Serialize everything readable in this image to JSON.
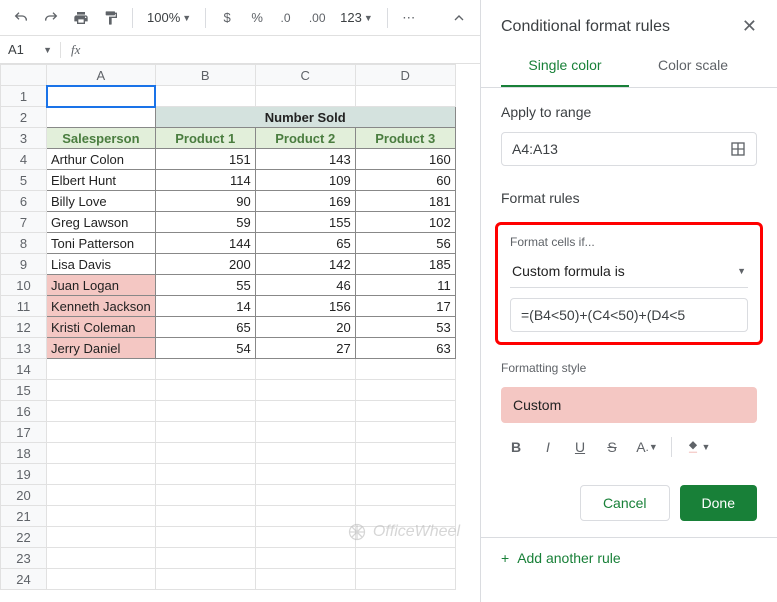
{
  "toolbar": {
    "zoom": "100%",
    "decimal": "123"
  },
  "namebox": "A1",
  "columns": [
    "A",
    "B",
    "C",
    "D"
  ],
  "header_merged": "Number Sold",
  "col_headers": [
    "Salesperson",
    "Product 1",
    "Product 2",
    "Product 3"
  ],
  "rows": [
    {
      "name": "Arthur Colon",
      "p1": 151,
      "p2": 143,
      "p3": 160,
      "hl": false
    },
    {
      "name": "Elbert Hunt",
      "p1": 114,
      "p2": 109,
      "p3": 60,
      "hl": false
    },
    {
      "name": "Billy Love",
      "p1": 90,
      "p2": 169,
      "p3": 181,
      "hl": false
    },
    {
      "name": "Greg Lawson",
      "p1": 59,
      "p2": 155,
      "p3": 102,
      "hl": false
    },
    {
      "name": "Toni Patterson",
      "p1": 144,
      "p2": 65,
      "p3": 56,
      "hl": false
    },
    {
      "name": "Lisa Davis",
      "p1": 200,
      "p2": 142,
      "p3": 185,
      "hl": false
    },
    {
      "name": "Juan Logan",
      "p1": 55,
      "p2": 46,
      "p3": 11,
      "hl": true
    },
    {
      "name": "Kenneth Jackson",
      "p1": 14,
      "p2": 156,
      "p3": 17,
      "hl": true
    },
    {
      "name": "Kristi Coleman",
      "p1": 65,
      "p2": 20,
      "p3": 53,
      "hl": true
    },
    {
      "name": "Jerry Daniel",
      "p1": 54,
      "p2": 27,
      "p3": 63,
      "hl": true
    }
  ],
  "watermark": "OfficeWheel",
  "panel": {
    "title": "Conditional format rules",
    "tab1": "Single color",
    "tab2": "Color scale",
    "apply_label": "Apply to range",
    "range": "A4:A13",
    "rules_label": "Format rules",
    "cells_if": "Format cells if...",
    "condition": "Custom formula is",
    "formula": "=(B4<50)+(C4<50)+(D4<5",
    "style_label": "Formatting style",
    "style_name": "Custom",
    "cancel": "Cancel",
    "done": "Done",
    "add": "Add another rule"
  }
}
